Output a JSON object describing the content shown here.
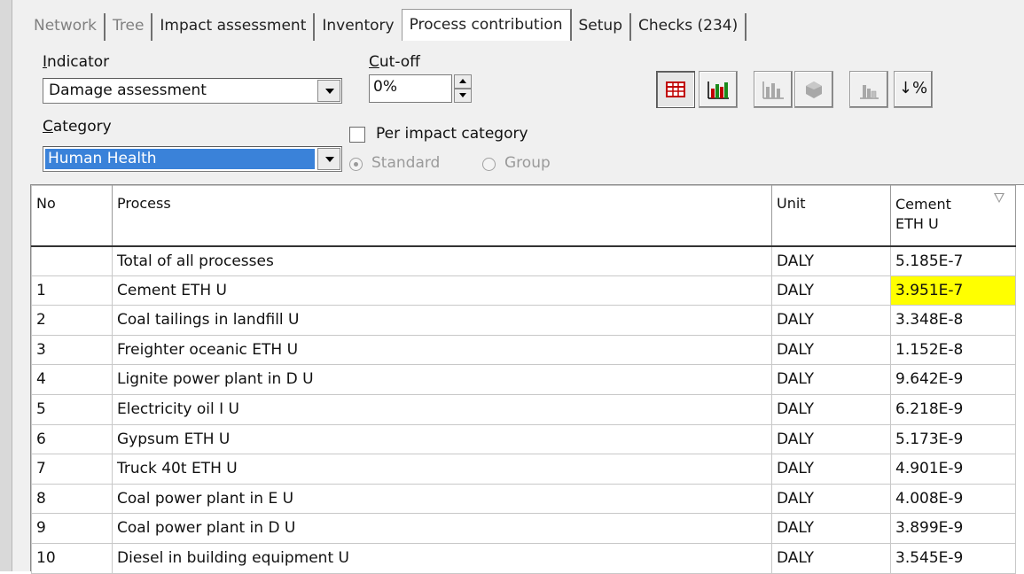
{
  "tabs": [
    {
      "label": "Network",
      "dim": true
    },
    {
      "label": "Tree",
      "dim": true
    },
    {
      "label": "Impact assessment",
      "dim": false
    },
    {
      "label": "Inventory",
      "dim": false
    },
    {
      "label": "Process contribution",
      "dim": false,
      "active": true
    },
    {
      "label": "Setup",
      "dim": false
    },
    {
      "label": "Checks (234)",
      "dim": false
    }
  ],
  "indicator": {
    "label_first": "I",
    "label_rest": "ndicator",
    "value": "Damage assessment"
  },
  "cutoff": {
    "label_first": "C",
    "label_rest": "ut-off",
    "value": "0%"
  },
  "category": {
    "label_first": "C",
    "label_rest": "ategory",
    "value": "Human Health"
  },
  "per_impact": {
    "label": "Per impact category",
    "checked": false
  },
  "radios": {
    "standard": "Standard",
    "group": "Group"
  },
  "toolbar": {
    "percent_sort_label": "↓%"
  },
  "colors": {
    "highlight": "#ffff00",
    "selection": "#3a82d9"
  },
  "table": {
    "headers": {
      "no": "No",
      "process": "Process",
      "unit": "Unit",
      "col1_line1": "Cement",
      "col1_line2": "ETH U"
    },
    "rows": [
      {
        "no": "",
        "process": "Total of all processes",
        "unit": "DALY",
        "value": "5.185E-7"
      },
      {
        "no": "1",
        "process": "Cement ETH U",
        "unit": "DALY",
        "value": "3.951E-7",
        "highlight": true
      },
      {
        "no": "2",
        "process": "Coal tailings in landfill U",
        "unit": "DALY",
        "value": "3.348E-8"
      },
      {
        "no": "3",
        "process": "Freighter oceanic ETH U",
        "unit": "DALY",
        "value": "1.152E-8"
      },
      {
        "no": "4",
        "process": "Lignite power plant in D U",
        "unit": "DALY",
        "value": "9.642E-9"
      },
      {
        "no": "5",
        "process": "Electricity oil I U",
        "unit": "DALY",
        "value": "6.218E-9"
      },
      {
        "no": "6",
        "process": "Gypsum ETH U",
        "unit": "DALY",
        "value": "5.173E-9"
      },
      {
        "no": "7",
        "process": "Truck 40t ETH U",
        "unit": "DALY",
        "value": "4.901E-9"
      },
      {
        "no": "8",
        "process": "Coal power plant in E U",
        "unit": "DALY",
        "value": "4.008E-9"
      },
      {
        "no": "9",
        "process": "Coal power plant in D U",
        "unit": "DALY",
        "value": "3.899E-9"
      },
      {
        "no": "10",
        "process": "Diesel in building equipment U",
        "unit": "DALY",
        "value": "3.545E-9"
      }
    ]
  }
}
